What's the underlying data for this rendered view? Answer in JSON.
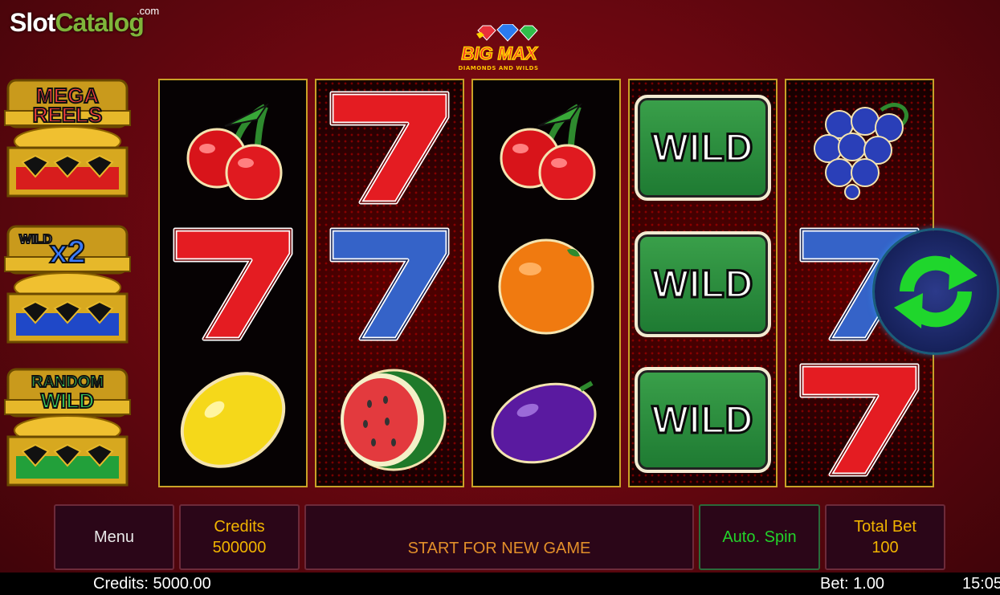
{
  "watermark": {
    "slot": "Slot",
    "catalog": "Catalog",
    "com": ".com"
  },
  "logo": {
    "title": "BIG MAX",
    "subtitle": "DIAMONDS AND WILDS"
  },
  "features": [
    {
      "line1": "MEGA",
      "line2": "REELS",
      "band_color": "#d81d1d"
    },
    {
      "line1": "WILD",
      "line2": "x2",
      "band_color": "#1f48c8"
    },
    {
      "line1": "RANDOM",
      "line2": "WILD",
      "band_color": "#22a03a"
    }
  ],
  "reels": [
    [
      "cherry",
      "seven-red",
      "lemon"
    ],
    [
      "seven-red",
      "seven-blue",
      "watermelon"
    ],
    [
      "cherry",
      "orange",
      "plum"
    ],
    [
      "wild",
      "wild",
      "wild"
    ],
    [
      "grapes",
      "seven-blue",
      "seven-red"
    ]
  ],
  "wild_label": "WILD",
  "controls": {
    "menu": "Menu",
    "credits_label": "Credits",
    "credits_value": "500000",
    "message": "START FOR NEW GAME",
    "autospin": "Auto. Spin",
    "totalbet_label": "Total Bet",
    "totalbet_value": "100",
    "spin_icon": "refresh-arrows-icon"
  },
  "status_bar": {
    "credits": "Credits: 5000.00",
    "bet": "Bet: 1.00",
    "time": "15:05"
  },
  "colors": {
    "frame_gold": "#c9a227",
    "panel_bg": "#2b0618",
    "gold_text": "#f1b400",
    "green_text": "#22d32a"
  }
}
